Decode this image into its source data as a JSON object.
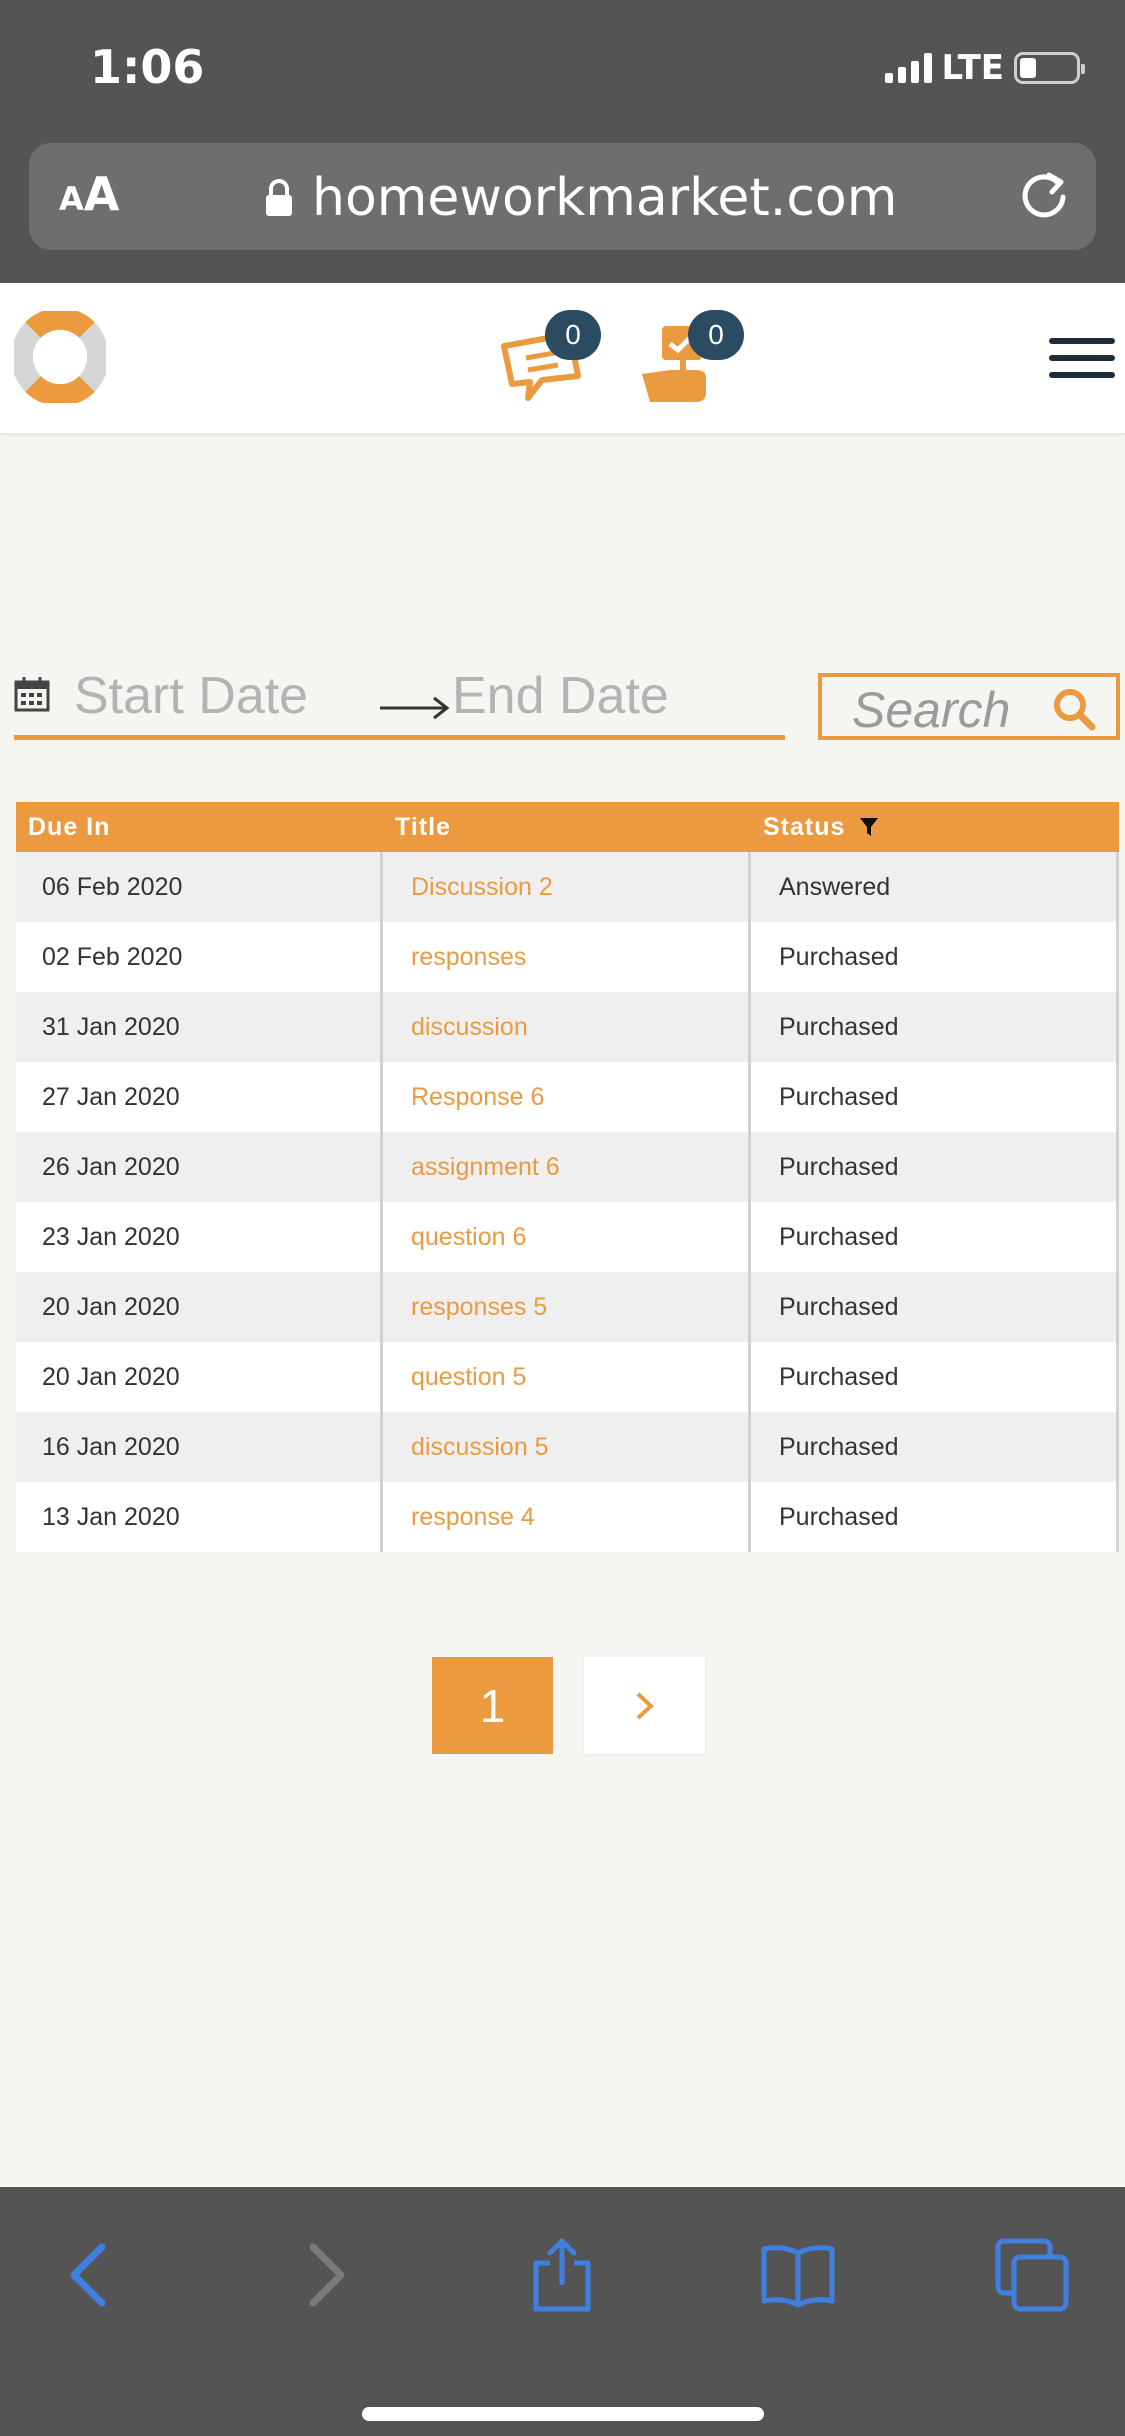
{
  "status_bar": {
    "time": "1:06",
    "network": "LTE"
  },
  "safari": {
    "text_size_label_small": "A",
    "text_size_label_big": "A",
    "domain": "homeworkmarket.com"
  },
  "header": {
    "messages_count": "0",
    "orders_count": "0"
  },
  "colors": {
    "accent": "#ec9a3f",
    "badge": "#2b4b63",
    "ios_bar": "#545454",
    "ios_blue": "#3e7fe0"
  },
  "filters": {
    "start_date_placeholder": "Start Date",
    "end_date_placeholder": "End Date",
    "search_placeholder": "Search"
  },
  "table": {
    "headers": {
      "due": "Due In",
      "title": "Title",
      "status": "Status"
    },
    "rows": [
      {
        "due": "06 Feb 2020",
        "title": "Discussion 2",
        "status": "Answered"
      },
      {
        "due": "02 Feb 2020",
        "title": "responses",
        "status": "Purchased"
      },
      {
        "due": "31 Jan 2020",
        "title": "discussion",
        "status": "Purchased"
      },
      {
        "due": "27 Jan 2020",
        "title": "Response 6",
        "status": "Purchased"
      },
      {
        "due": "26 Jan 2020",
        "title": "assignment 6",
        "status": "Purchased"
      },
      {
        "due": "23 Jan 2020",
        "title": "question 6",
        "status": "Purchased"
      },
      {
        "due": "20 Jan 2020",
        "title": "responses 5",
        "status": "Purchased"
      },
      {
        "due": "20 Jan 2020",
        "title": "question 5",
        "status": "Purchased"
      },
      {
        "due": "16 Jan 2020",
        "title": "discussion 5",
        "status": "Purchased"
      },
      {
        "due": "13 Jan 2020",
        "title": "response 4",
        "status": "Purchased"
      }
    ]
  },
  "pagination": {
    "current_page": "1",
    "next_symbol": "›"
  },
  "icons": {
    "status_bar": [
      "signal-icon",
      "battery-icon"
    ],
    "safari": [
      "lock-icon",
      "reload-icon"
    ],
    "header": [
      "logo-icon",
      "messages-icon",
      "orders-hand-icon",
      "hamburger-menu-icon"
    ],
    "filters": [
      "calendar-icon",
      "arrow-right-icon",
      "search-icon"
    ],
    "table": [
      "filter-icon"
    ],
    "toolbar": [
      "back-icon",
      "forward-icon",
      "share-icon",
      "bookmarks-icon",
      "tabs-icon"
    ]
  }
}
